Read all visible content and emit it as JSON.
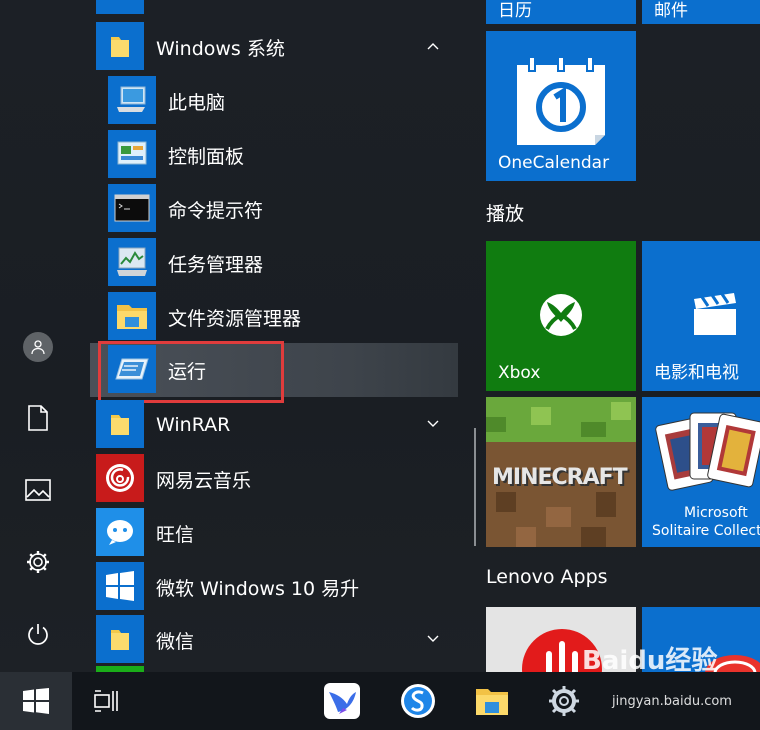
{
  "app_list": {
    "group": {
      "label": "Windows 系统"
    },
    "items": [
      {
        "label": "此电脑",
        "icon": "computer-icon"
      },
      {
        "label": "控制面板",
        "icon": "control-panel-icon"
      },
      {
        "label": "命令提示符",
        "icon": "command-prompt-icon"
      },
      {
        "label": "任务管理器",
        "icon": "task-manager-icon"
      },
      {
        "label": "文件资源管理器",
        "icon": "file-explorer-icon"
      },
      {
        "label": "运行",
        "icon": "run-icon"
      }
    ],
    "more": [
      {
        "label": "WinRAR",
        "icon": "folder-icon"
      },
      {
        "label": "网易云音乐",
        "icon": "netease-music-icon"
      },
      {
        "label": "旺信",
        "icon": "wangxin-icon"
      },
      {
        "label": "微软 Windows 10 易升",
        "icon": "windows-logo-icon"
      },
      {
        "label": "微信",
        "icon": "folder-icon"
      }
    ]
  },
  "tiles": {
    "calendar_label": "日历",
    "mail_label": "邮件",
    "onecalendar_label": "OneCalendar",
    "play_group": "播放",
    "xbox_label": "Xbox",
    "movies_label": "电影和电视",
    "solitaire_line1": "Microsoft",
    "solitaire_line2": "Solitaire Collect",
    "minecraft_text": "MINECRAFT",
    "lenovo_group": "Lenovo Apps"
  },
  "watermark": {
    "text": "Baidu经验",
    "url": "jingyan.baidu.com"
  },
  "colors": {
    "accent": "#0b6fce",
    "tile_green": "#107c10",
    "highlight_box": "#e03c3c"
  }
}
